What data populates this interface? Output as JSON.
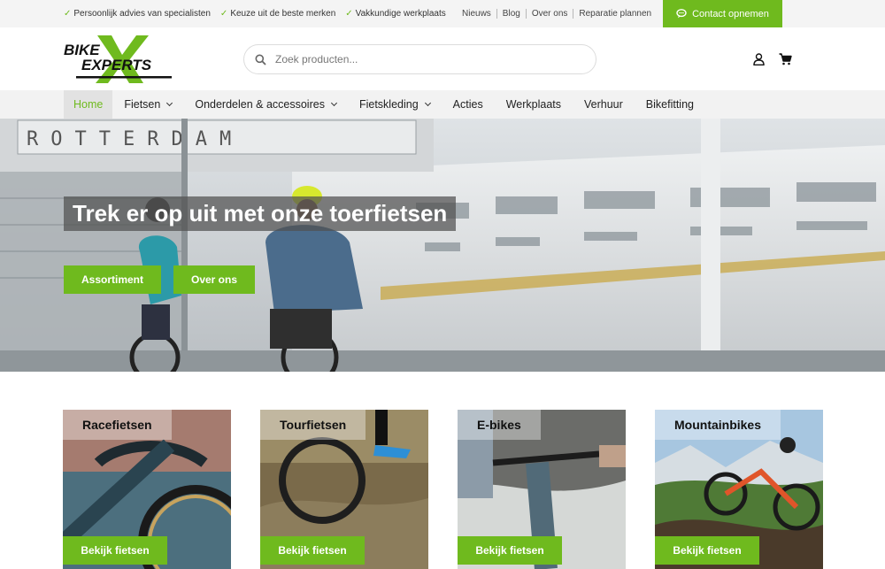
{
  "topbar": {
    "usps": [
      "Persoonlijk advies van specialisten",
      "Keuze uit de beste merken",
      "Vakkundige werkplaats"
    ],
    "links": [
      "Nieuws",
      "Blog",
      "Over ons",
      "Reparatie plannen"
    ],
    "contact_label": "Contact opnemen"
  },
  "header": {
    "logo_text_top": "BIKE",
    "logo_text_bottom": "EXPERTS",
    "search_placeholder": "Zoek producten..."
  },
  "nav": {
    "items": [
      {
        "label": "Home",
        "active": true,
        "dropdown": false
      },
      {
        "label": "Fietsen",
        "active": false,
        "dropdown": true
      },
      {
        "label": "Onderdelen & accessoires",
        "active": false,
        "dropdown": true
      },
      {
        "label": "Fietskleding",
        "active": false,
        "dropdown": true
      },
      {
        "label": "Acties",
        "active": false,
        "dropdown": false
      },
      {
        "label": "Werkplaats",
        "active": false,
        "dropdown": false
      },
      {
        "label": "Verhuur",
        "active": false,
        "dropdown": false
      },
      {
        "label": "Bikefitting",
        "active": false,
        "dropdown": false
      }
    ]
  },
  "hero": {
    "sign_text": "ROTTERDAM",
    "title": "Trek er op uit met onze toerfietsen",
    "primary_button": "Assortiment",
    "secondary_button": "Over ons"
  },
  "categories": [
    {
      "title": "Racefietsen",
      "button": "Bekijk fietsen"
    },
    {
      "title": "Tourfietsen",
      "button": "Bekijk fietsen"
    },
    {
      "title": "E-bikes",
      "button": "Bekijk fietsen"
    },
    {
      "title": "Mountainbikes",
      "button": "Bekijk fietsen"
    }
  ],
  "colors": {
    "brand_green": "#6fba1e",
    "nav_bg": "#f2f2f2",
    "topbar_bg": "#f4f4f4"
  }
}
